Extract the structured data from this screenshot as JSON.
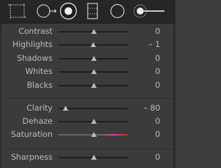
{
  "toolbar": {
    "tools": [
      {
        "icon": "crop-overlay-icon"
      },
      {
        "icon": "spot-removal-icon"
      },
      {
        "icon": "red-eye-correction-icon"
      },
      {
        "icon": "graduated-filter-icon"
      },
      {
        "icon": "radial-filter-icon"
      },
      {
        "icon": "adjustment-brush-icon"
      }
    ]
  },
  "sliders": [
    {
      "id": "contrast",
      "label": "Contrast",
      "value": "0",
      "level": 0
    },
    {
      "id": "highlights",
      "label": "Highlights",
      "value": "– 1",
      "level": -1
    },
    {
      "id": "shadows",
      "label": "Shadows",
      "value": "0",
      "level": 0
    },
    {
      "id": "whites",
      "label": "Whites",
      "value": "0",
      "level": 0
    },
    {
      "id": "blacks",
      "label": "Blacks",
      "value": "0",
      "level": 0
    },
    {
      "id": "clarity",
      "label": "Clarity",
      "value": "– 80",
      "level": -80
    },
    {
      "id": "dehaze",
      "label": "Dehaze",
      "value": "0",
      "level": 0
    },
    {
      "id": "saturation",
      "label": "Saturation",
      "value": "0",
      "level": 0
    },
    {
      "id": "sharpness",
      "label": "Sharpness",
      "value": "0",
      "level": 0
    }
  ],
  "colors": {
    "panel": "#3b3b3b",
    "toolbar": "#262626",
    "text": "#bdbdbd",
    "track": "#1d1d1d",
    "saturation_end": "#d02020"
  }
}
